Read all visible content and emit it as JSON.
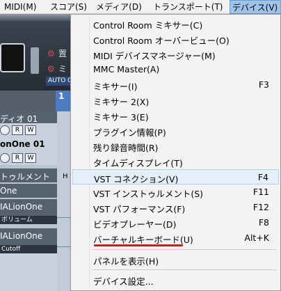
{
  "menubar": {
    "items": [
      {
        "label": "MIDI(M)"
      },
      {
        "label": "スコア(S)"
      },
      {
        "label": "メディア(D)"
      },
      {
        "label": "トランスポート(T)"
      },
      {
        "label": "デバイス(V)",
        "active": true
      }
    ]
  },
  "background": {
    "transport": {
      "label_1": "置",
      "label_2": "ミ",
      "auto_button": "AUTO C"
    },
    "ruler_mark": "1",
    "tracks": [
      {
        "name": "ディオ 01"
      },
      {
        "name": "onOne 01"
      },
      {
        "name": "トゥルメント"
      },
      {
        "name": "One"
      },
      {
        "name": "IALionOne",
        "sub": "ボリューム"
      },
      {
        "name": "IALionOne",
        "sub": "Cutoff"
      }
    ],
    "track_button_r": "R",
    "track_button_w": "W",
    "lane_label": "H"
  },
  "device_menu": {
    "items": [
      {
        "label": "Control Room ミキサー(C)",
        "shortcut": ""
      },
      {
        "label": "Control Room オーバービュー(O)",
        "shortcut": ""
      },
      {
        "label": "MIDI デバイスマネージャー(M)",
        "shortcut": ""
      },
      {
        "label": "MMC Master(A)",
        "shortcut": ""
      },
      {
        "label": "ミキサー(I)",
        "shortcut": "F3"
      },
      {
        "label": "ミキサー 2(X)",
        "shortcut": ""
      },
      {
        "label": "ミキサー 3(E)",
        "shortcut": ""
      },
      {
        "label": "プラグイン情報(P)",
        "shortcut": ""
      },
      {
        "label": "残り録音時間(R)",
        "shortcut": ""
      },
      {
        "label": "タイムディスプレイ(T)",
        "shortcut": ""
      },
      {
        "label": "VST コネクション(V)",
        "shortcut": "F4",
        "highlighted": true
      },
      {
        "label": "VST インストゥルメント(S)",
        "shortcut": "F11"
      },
      {
        "label": "VST パフォーマンス(F)",
        "shortcut": "F12"
      },
      {
        "label": "ビデオプレーヤー(D)",
        "shortcut": "F8"
      },
      {
        "label": "バーチャルキーボード(U)",
        "shortcut": "Alt+K"
      },
      {
        "label": "パネルを表示(H)",
        "shortcut": ""
      },
      {
        "label": "デバイス設定...",
        "shortcut": ""
      }
    ]
  },
  "colors": {
    "annotation_red": "#e0141e",
    "menu_highlight": "#e5effa",
    "active_menu": "#9fc4ea"
  }
}
